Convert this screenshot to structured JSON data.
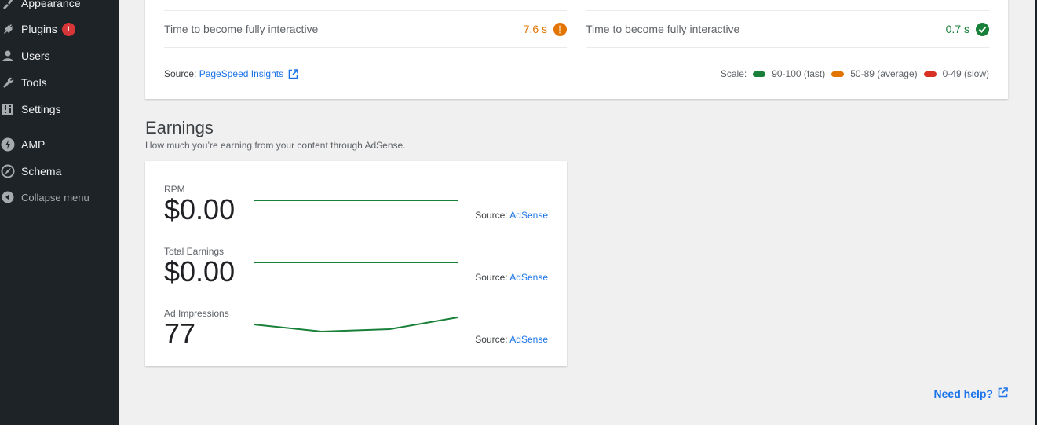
{
  "sidebar": {
    "items": [
      {
        "label": "Appearance",
        "icon": "paintbrush-icon"
      },
      {
        "label": "Plugins",
        "icon": "plugin-icon",
        "badge": "1"
      },
      {
        "label": "Users",
        "icon": "user-icon"
      },
      {
        "label": "Tools",
        "icon": "wrench-icon"
      },
      {
        "label": "Settings",
        "icon": "settings-icon"
      },
      {
        "label": "AMP",
        "icon": "amp-bolt-icon"
      },
      {
        "label": "Schema",
        "icon": "compass-icon"
      },
      {
        "label": "Collapse menu",
        "icon": "collapse-arrow-icon"
      }
    ]
  },
  "speed": {
    "left_metric": {
      "label": "Time to become fully interactive",
      "value": "7.6 s",
      "status": "average"
    },
    "right_metric": {
      "label": "Time to become fully interactive",
      "value": "0.7 s",
      "status": "fast"
    },
    "source_prefix": "Source:",
    "source_link": "PageSpeed Insights",
    "scale": {
      "label": "Scale:",
      "fast": "90-100 (fast)",
      "average": "50-89 (average)",
      "slow": "0-49 (slow)"
    },
    "colors": {
      "fast": "#188038",
      "average": "#e37400",
      "slow": "#d93025"
    }
  },
  "earnings": {
    "title": "Earnings",
    "description": "How much you’re earning from your content through AdSense.",
    "stats": [
      {
        "label": "RPM",
        "value": "$0.00",
        "source_prefix": "Source:",
        "source_link": "AdSense",
        "trend": [
          0,
          0,
          0,
          0
        ]
      },
      {
        "label": "Total Earnings",
        "value": "$0.00",
        "source_prefix": "Source:",
        "source_link": "AdSense",
        "trend": [
          0,
          0,
          0,
          0
        ]
      },
      {
        "label": "Ad Impressions",
        "value": "77",
        "source_prefix": "Source:",
        "source_link": "AdSense",
        "trend": [
          20,
          5,
          10,
          35
        ]
      }
    ],
    "line_color": "#188038"
  },
  "help": {
    "label": "Need help?"
  }
}
